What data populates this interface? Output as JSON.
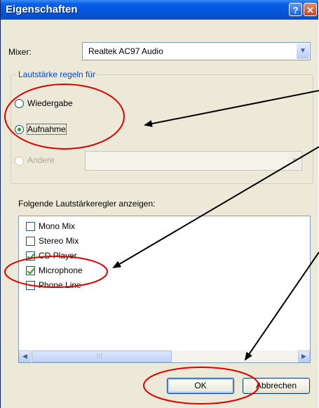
{
  "window": {
    "title": "Eigenschaften",
    "help_glyph": "?",
    "close_glyph": "✕"
  },
  "mixer": {
    "label": "Mixer:",
    "value": "Realtek AC97 Audio"
  },
  "volume_group": {
    "title": "Lautstärke regeln für",
    "options": [
      {
        "label": "Wiedergabe",
        "checked": false,
        "enabled": true
      },
      {
        "label": "Aufnahme",
        "checked": true,
        "enabled": true
      },
      {
        "label": "Andere",
        "checked": false,
        "enabled": false
      }
    ]
  },
  "controls": {
    "label": "Folgende Lautstärkeregler anzeigen:",
    "items": [
      {
        "label": "Mono Mix",
        "checked": false
      },
      {
        "label": "Stereo Mix",
        "checked": false
      },
      {
        "label": "CD Player",
        "checked": true
      },
      {
        "label": "Microphone",
        "checked": true
      },
      {
        "label": "Phone Line",
        "checked": false
      }
    ]
  },
  "buttons": {
    "ok": "OK",
    "cancel": "Abbrechen"
  },
  "annotation_color": "#e00000"
}
